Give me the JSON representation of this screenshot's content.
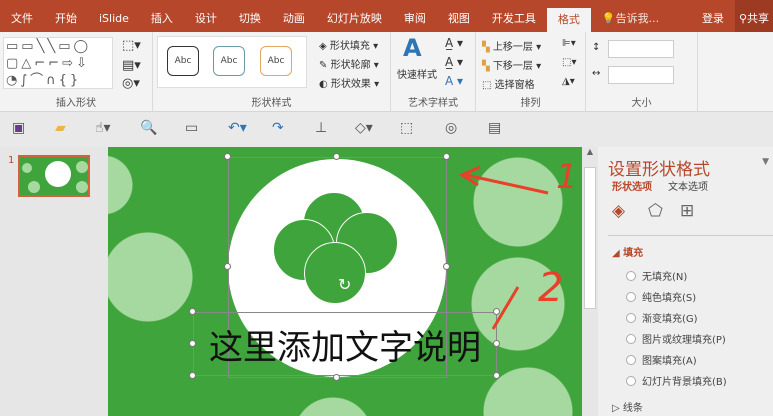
{
  "tabs": [
    "文件",
    "开始",
    "iSlide",
    "插入",
    "设计",
    "切换",
    "动画",
    "幻灯片放映",
    "审阅",
    "视图",
    "开发工具",
    "格式"
  ],
  "active_tab": "格式",
  "tell_me": "告诉我...",
  "login": "登录",
  "share": "共享",
  "groups": {
    "insert_shapes": "插入形状",
    "shape_styles": "形状样式",
    "wordart": "艺术字样式",
    "arrange": "排列",
    "size": "大小"
  },
  "shape_style_samples": [
    "Abc",
    "Abc",
    "Abc"
  ],
  "shape_buttons": [
    "形状填充",
    "形状轮廓",
    "形状效果"
  ],
  "quick_style": "快速样式",
  "arrange_buttons": [
    "上移一层",
    "下移一层",
    "选择窗格"
  ],
  "slide_number": "1",
  "slide_text": "这里添加文字说明",
  "annotations": [
    "1",
    "2"
  ],
  "pane": {
    "title": "设置形状格式",
    "tabs": [
      "形状选项",
      "文本选项"
    ],
    "section": "填充",
    "options": [
      "无填充(N)",
      "纯色填充(S)",
      "渐变填充(G)",
      "图片或纹理填充(P)",
      "图案填充(A)",
      "幻灯片背景填充(B)"
    ],
    "next_section": "线条"
  },
  "colors": {
    "accent": "#b7472a",
    "slide_green": "#3fa43b",
    "light_green": "#a6d9a0"
  }
}
